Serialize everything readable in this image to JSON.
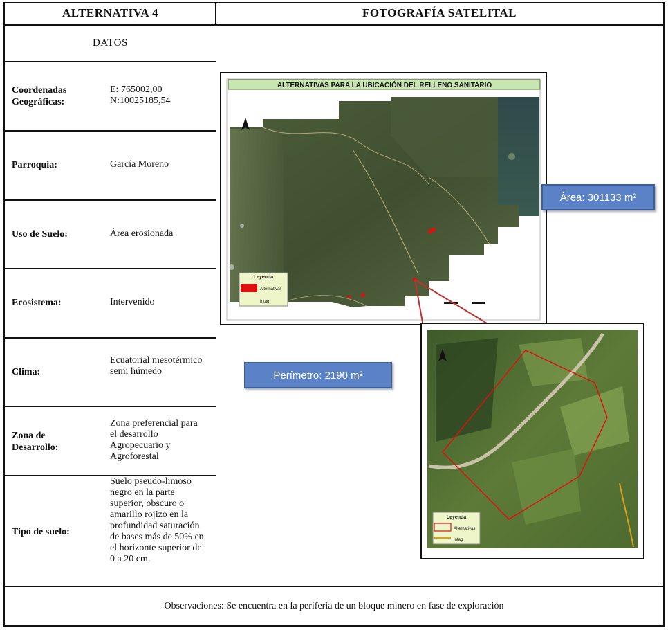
{
  "header": {
    "left_title": "ALTERNATIVA 4",
    "right_title": "FOTOGRAFÍA SATELITAL"
  },
  "datos_label": "DATOS",
  "rows": [
    {
      "label": "Coordenadas Geográficas:",
      "value_line1": "E: 765002,00",
      "value_line2": "N:10025185,54"
    },
    {
      "label": "Parroquia:",
      "value": "García Moreno"
    },
    {
      "label": "Uso de Suelo:",
      "value": "Área erosionada"
    },
    {
      "label": "Ecosistema:",
      "value": "Intervenido"
    },
    {
      "label": "Clima:",
      "value": "Ecuatorial mesotérmico semi húmedo"
    },
    {
      "label": "Zona de Desarrollo:",
      "value": "Zona preferencial para el desarrollo Agropecuario y Agroforestal"
    },
    {
      "label": "Tipo de suelo:",
      "value": "Suelo pseudo-limoso negro en la parte superior, obscuro o amarillo rojizo en la profundidad saturación de bases más de 50% en el horizonte superior de 0 a 20 cm."
    }
  ],
  "observaciones": "Observaciones: Se encuentra en la periferia de un bloque minero en fase de exploración",
  "map_main": {
    "title": "ALTERNATIVAS PARA LA UBICACIÓN DEL RELLENO SANITARIO",
    "legend_title": "Leyenda",
    "legend_items": [
      "Alternativas",
      "Intag"
    ]
  },
  "map_detail": {
    "legend_title": "Leyenda",
    "legend_items": [
      "Alternativas",
      "Intag"
    ]
  },
  "callouts": {
    "area": "Área: 301133 m²",
    "perimetro": "Perímetro: 2190 m²"
  },
  "colors": {
    "callout_fill": "#5b82c6",
    "alternative_red": "#e01010",
    "map_title_bar": "#c8e6b0"
  }
}
